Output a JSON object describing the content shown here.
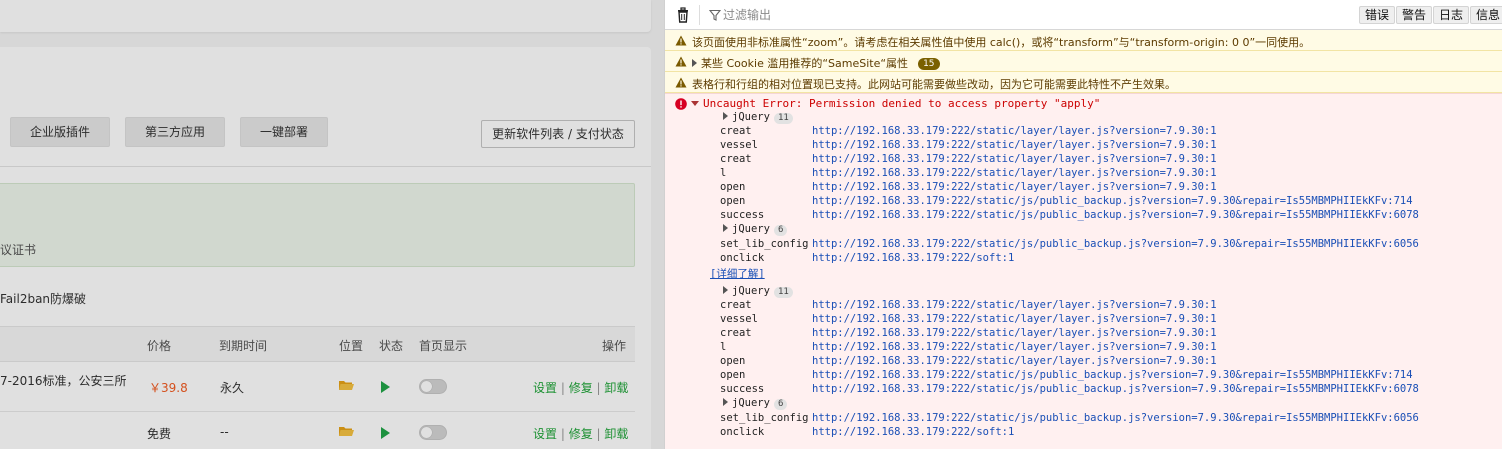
{
  "app": {
    "buttons": [
      "企业版插件",
      "第三方应用",
      "一键部署"
    ],
    "update_button": "更新软件列表 / 支付状态",
    "notice_text": "议证书",
    "fail2ban_text": "Fail2ban防爆破",
    "table": {
      "headers": {
        "price": "价格",
        "expire": "到期时间",
        "location": "位置",
        "status": "状态",
        "home": "首页显示",
        "actions": "操作"
      },
      "rows": [
        {
          "desc": "7-2016标准，公安三所",
          "price": "￥39.8",
          "expire": "永久",
          "actions": [
            "设置",
            "修复",
            "卸载"
          ]
        },
        {
          "desc": "",
          "price": "免费",
          "expire": "--",
          "actions": [
            "设置",
            "修复",
            "卸载"
          ]
        }
      ],
      "action_separator": "|"
    }
  },
  "console": {
    "filter_placeholder": "过滤输出",
    "levels": [
      "错误",
      "警告",
      "日志",
      "信息"
    ],
    "warnings": [
      {
        "text": "该页面使用非标准属性“zoom”。请考虑在相关属性值中使用 calc()，或将“transform”与“transform-origin: 0 0”一同使用。"
      },
      {
        "text": "某些 Cookie 滥用推荐的“SameSite“属性",
        "count": "15"
      },
      {
        "text": "表格行和行组的相对位置现已支持。此网站可能需要做些改动，因为它可能需要此特性不产生效果。"
      }
    ],
    "error": {
      "message": "Uncaught Error: Permission denied to access property \"apply\"",
      "learn_more": "[详细了解]",
      "stack_a": [
        {
          "type": "group",
          "name": "jQuery",
          "count": "11"
        },
        {
          "fn": "creat",
          "url": "http://192.168.33.179:222/static/layer/layer.js?version=7.9.30:1"
        },
        {
          "fn": "vessel",
          "url": "http://192.168.33.179:222/static/layer/layer.js?version=7.9.30:1"
        },
        {
          "fn": "creat",
          "url": "http://192.168.33.179:222/static/layer/layer.js?version=7.9.30:1"
        },
        {
          "fn": "l",
          "url": "http://192.168.33.179:222/static/layer/layer.js?version=7.9.30:1"
        },
        {
          "fn": "open",
          "url": "http://192.168.33.179:222/static/layer/layer.js?version=7.9.30:1"
        },
        {
          "fn": "open",
          "url": "http://192.168.33.179:222/static/js/public_backup.js?version=7.9.30&repair=Is55MBMPHIIEkKFv:714"
        },
        {
          "fn": "success",
          "url": "http://192.168.33.179:222/static/js/public_backup.js?version=7.9.30&repair=Is55MBMPHIIEkKFv:6078"
        },
        {
          "type": "group",
          "name": "jQuery",
          "count": "6"
        },
        {
          "fn": "set_lib_config",
          "url": "http://192.168.33.179:222/static/js/public_backup.js?version=7.9.30&repair=Is55MBMPHIIEkKFv:6056"
        },
        {
          "fn": "onclick",
          "url": "http://192.168.33.179:222/soft:1"
        }
      ],
      "stack_b": [
        {
          "type": "group",
          "name": "jQuery",
          "count": "11"
        },
        {
          "fn": "creat",
          "url": "http://192.168.33.179:222/static/layer/layer.js?version=7.9.30:1"
        },
        {
          "fn": "vessel",
          "url": "http://192.168.33.179:222/static/layer/layer.js?version=7.9.30:1"
        },
        {
          "fn": "creat",
          "url": "http://192.168.33.179:222/static/layer/layer.js?version=7.9.30:1"
        },
        {
          "fn": "l",
          "url": "http://192.168.33.179:222/static/layer/layer.js?version=7.9.30:1"
        },
        {
          "fn": "open",
          "url": "http://192.168.33.179:222/static/layer/layer.js?version=7.9.30:1"
        },
        {
          "fn": "open",
          "url": "http://192.168.33.179:222/static/js/public_backup.js?version=7.9.30&repair=Is55MBMPHIIEkKFv:714"
        },
        {
          "fn": "success",
          "url": "http://192.168.33.179:222/static/js/public_backup.js?version=7.9.30&repair=Is55MBMPHIIEkKFv:6078"
        },
        {
          "type": "group",
          "name": "jQuery",
          "count": "6"
        },
        {
          "fn": "set_lib_config",
          "url": "http://192.168.33.179:222/static/js/public_backup.js?version=7.9.30&repair=Is55MBMPHIIEkKFv:6056"
        },
        {
          "fn": "onclick",
          "url": "http://192.168.33.179:222/soft:1"
        }
      ]
    }
  },
  "colors": {
    "link_blue": "#1a4fb6",
    "error_red": "#c00000",
    "action_green": "#20a53a",
    "price_orange": "#f25c22"
  }
}
